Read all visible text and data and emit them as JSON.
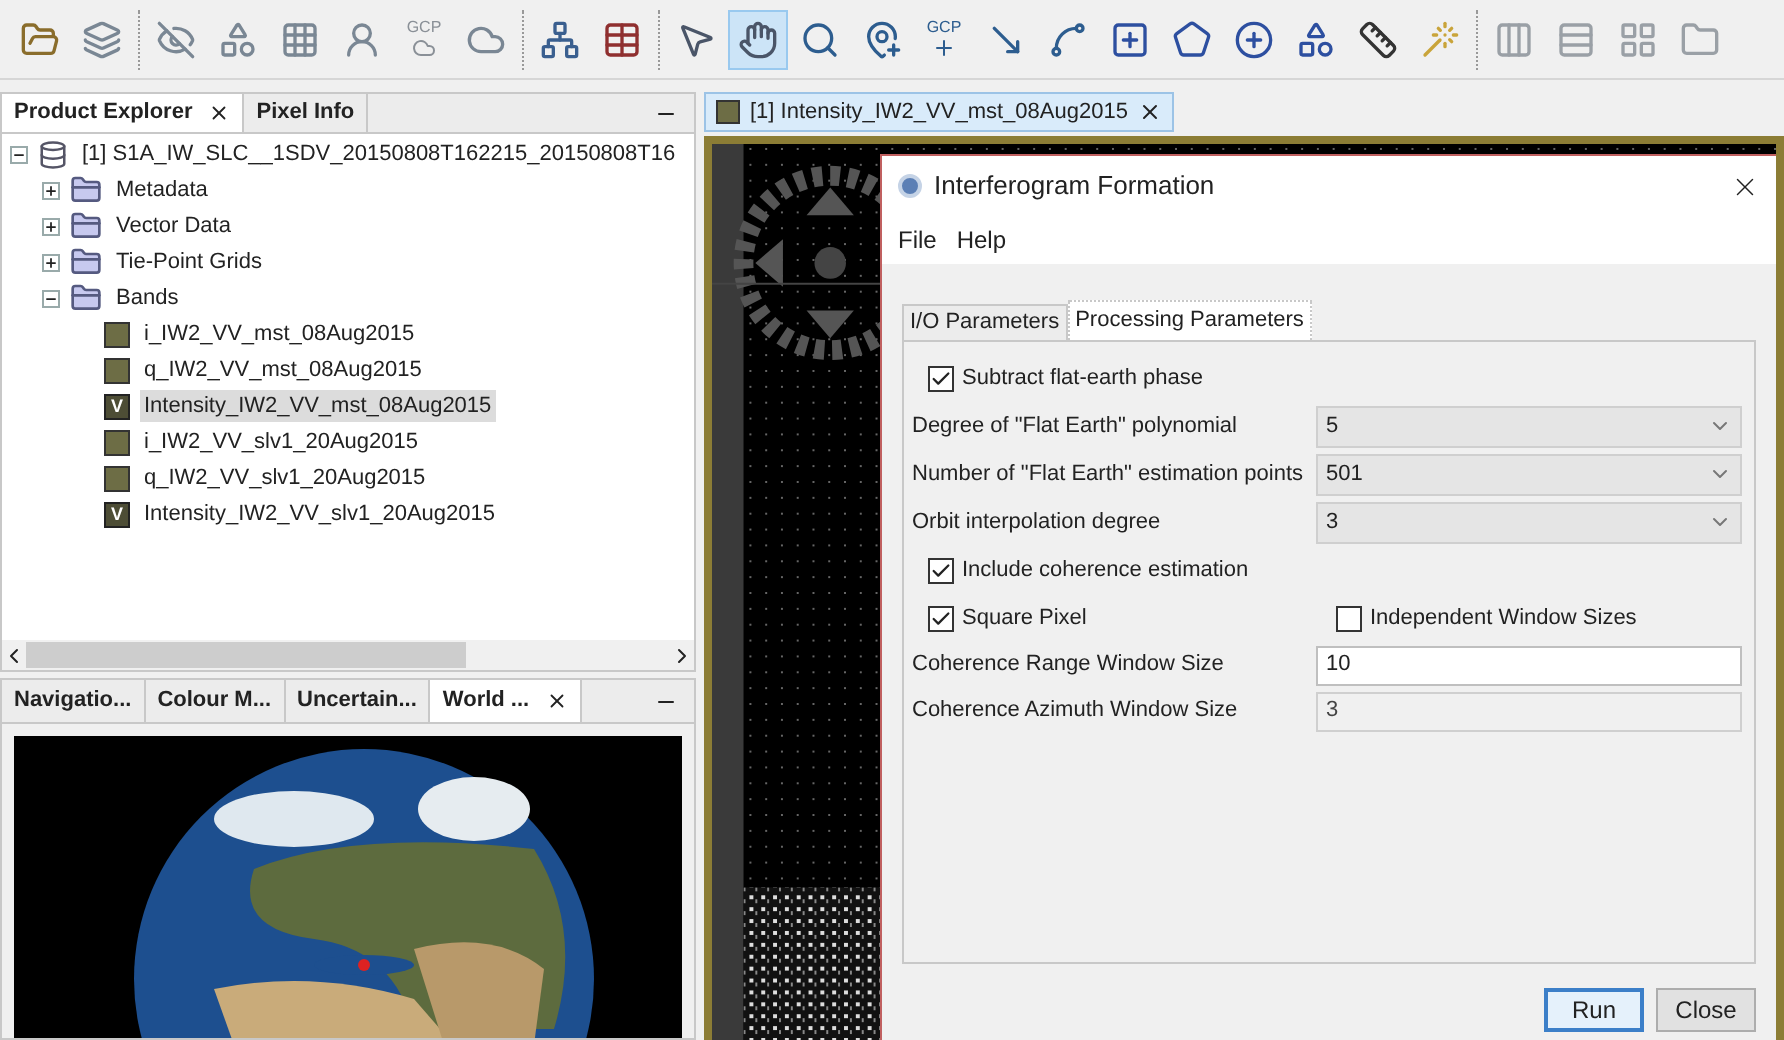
{
  "toolbar": {
    "groups": [
      [
        {
          "kind": "open-folder",
          "selected": false
        },
        {
          "kind": "layers",
          "selected": false
        }
      ],
      [
        {
          "kind": "eye-off",
          "selected": false
        },
        {
          "kind": "shapes",
          "selected": false
        },
        {
          "kind": "grid",
          "selected": false
        },
        {
          "kind": "user",
          "selected": false
        },
        {
          "kind": "gcp",
          "label": "GCP",
          "selected": false
        },
        {
          "kind": "blob",
          "selected": false
        }
      ],
      [
        {
          "kind": "network",
          "selected": false
        },
        {
          "kind": "table",
          "selected": false
        }
      ],
      [
        {
          "kind": "pointer",
          "selected": false
        },
        {
          "kind": "hand",
          "selected": true
        },
        {
          "kind": "zoom",
          "selected": false
        },
        {
          "kind": "pin-plus",
          "selected": false
        },
        {
          "kind": "gcp-plus",
          "label": "GCP",
          "selected": false
        },
        {
          "kind": "line",
          "selected": false
        },
        {
          "kind": "polyline",
          "selected": false
        },
        {
          "kind": "rect",
          "selected": false
        },
        {
          "kind": "polygon",
          "selected": false
        },
        {
          "kind": "ellipse",
          "selected": false
        },
        {
          "kind": "shapes-plus",
          "selected": false
        },
        {
          "kind": "ruler",
          "selected": false
        },
        {
          "kind": "wand",
          "selected": false
        }
      ],
      [
        {
          "kind": "columns",
          "selected": false
        },
        {
          "kind": "rows",
          "selected": false
        },
        {
          "kind": "tiles",
          "selected": false
        },
        {
          "kind": "folder",
          "selected": false
        }
      ]
    ]
  },
  "explorer": {
    "tabs": [
      {
        "label": "Product Explorer",
        "closable": true,
        "selected": true
      },
      {
        "label": "Pixel Info",
        "closable": false,
        "selected": false
      }
    ],
    "tree": [
      {
        "label": "[1] S1A_IW_SLC__1SDV_20150808T162215_20150808T16",
        "kind": "product",
        "expanded": true,
        "selected": false,
        "children": [
          {
            "label": "Metadata",
            "kind": "folder",
            "expanded": false,
            "selected": false
          },
          {
            "label": "Vector Data",
            "kind": "folder",
            "expanded": false,
            "selected": false
          },
          {
            "label": "Tie-Point Grids",
            "kind": "folder",
            "expanded": false,
            "selected": false
          },
          {
            "label": "Bands",
            "kind": "folder",
            "expanded": true,
            "selected": false,
            "children": [
              {
                "label": "i_IW2_VV_mst_08Aug2015",
                "kind": "band",
                "selected": false
              },
              {
                "label": "q_IW2_VV_mst_08Aug2015",
                "kind": "band",
                "selected": false
              },
              {
                "label": "Intensity_IW2_VV_mst_08Aug2015",
                "kind": "virtual-band",
                "badge": "V",
                "selected": true
              },
              {
                "label": "i_IW2_VV_slv1_20Aug2015",
                "kind": "band",
                "selected": false
              },
              {
                "label": "q_IW2_VV_slv1_20Aug2015",
                "kind": "band",
                "selected": false
              },
              {
                "label": "Intensity_IW2_VV_slv1_20Aug2015",
                "kind": "virtual-band",
                "badge": "V",
                "selected": false
              }
            ]
          }
        ]
      }
    ]
  },
  "tool_panel": {
    "tabs": [
      {
        "label": "Navigatio...",
        "closable": false,
        "selected": false
      },
      {
        "label": "Colour M...",
        "closable": false,
        "selected": false
      },
      {
        "label": "Uncertain...",
        "closable": false,
        "selected": false
      },
      {
        "label": "World ...",
        "closable": true,
        "selected": true
      }
    ]
  },
  "image_window": {
    "tab": {
      "label": "[1] Intensity_IW2_VV_mst_08Aug2015",
      "selected": true
    }
  },
  "dialog": {
    "title": "Interferogram Formation",
    "menu": [
      "File",
      "Help"
    ],
    "tabs": [
      {
        "label": "I/O Parameters",
        "selected": false
      },
      {
        "label": "Processing Parameters",
        "selected": true
      }
    ],
    "rows": [
      {
        "kind": "checkbox",
        "items": [
          {
            "label": "Subtract flat-earth phase",
            "checked": true
          }
        ]
      },
      {
        "kind": "select",
        "label": "Degree of \"Flat Earth\" polynomial",
        "value": "5"
      },
      {
        "kind": "select",
        "label": "Number of \"Flat Earth\" estimation points",
        "value": "501"
      },
      {
        "kind": "select",
        "label": "Orbit interpolation degree",
        "value": "3"
      },
      {
        "kind": "checkbox",
        "items": [
          {
            "label": "Include coherence estimation",
            "checked": true
          }
        ]
      },
      {
        "kind": "checkbox",
        "items": [
          {
            "label": "Square Pixel",
            "checked": true
          },
          {
            "label": "Independent Window Sizes",
            "checked": false
          }
        ]
      },
      {
        "kind": "text",
        "label": "Coherence Range Window Size",
        "value": "10",
        "disabled": false
      },
      {
        "kind": "text",
        "label": "Coherence Azimuth Window Size",
        "value": "3",
        "disabled": true
      }
    ],
    "buttons": [
      {
        "label": "Run",
        "default": true
      },
      {
        "label": "Close",
        "default": false
      }
    ]
  }
}
